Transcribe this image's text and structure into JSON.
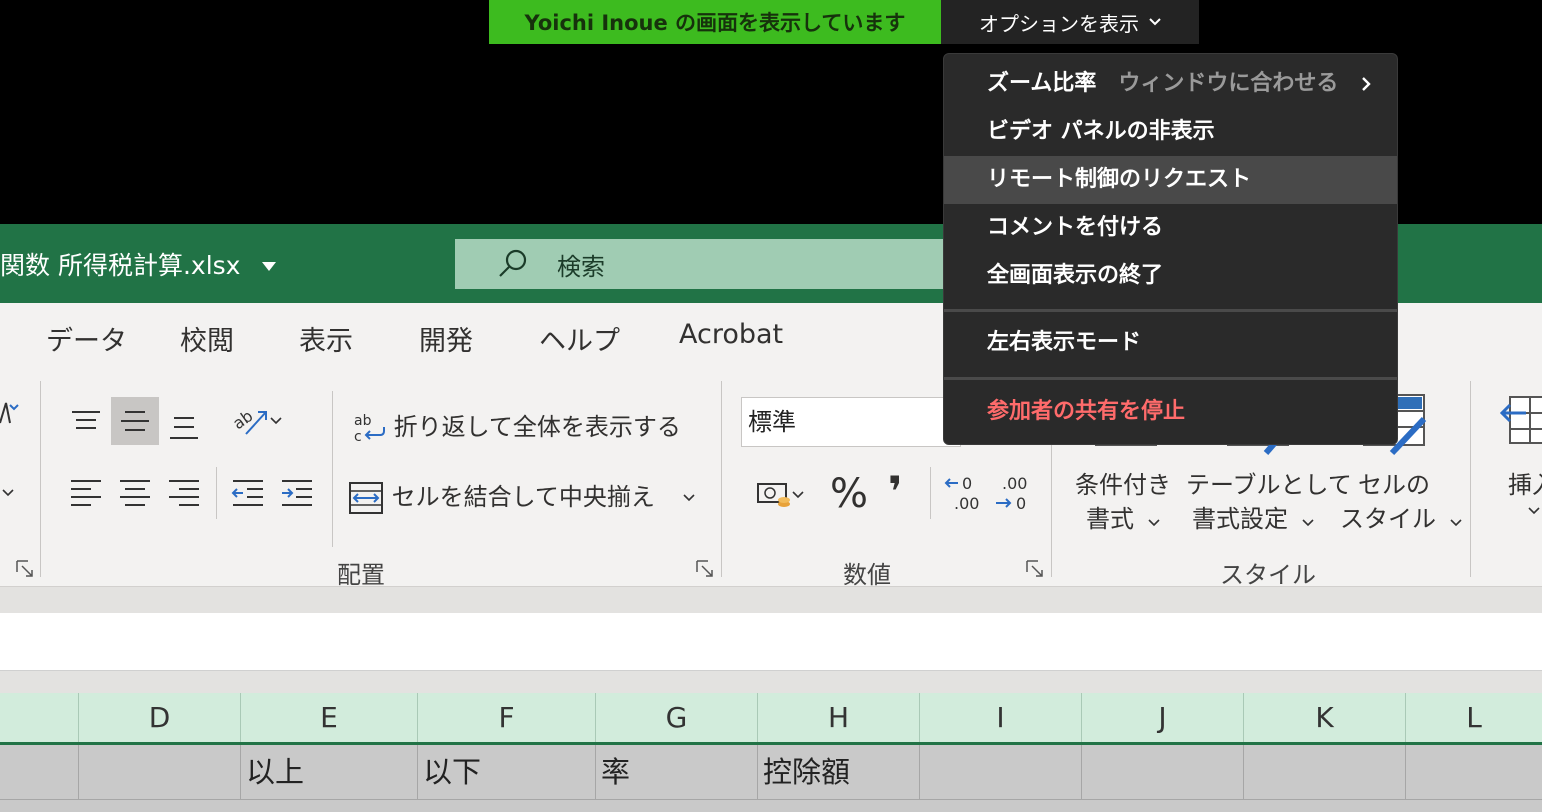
{
  "zoom": {
    "share_status": "Yoichi Inoue の画面を表示しています",
    "options_label": "オプションを表示",
    "menu": {
      "zoom_label": "ズーム比率",
      "zoom_value": "ウィンドウに合わせる",
      "hide_video": "ビデオ パネルの非表示",
      "request_control": "リモート制御のリクエスト",
      "annotate": "コメントを付ける",
      "exit_fullscreen": "全画面表示の終了",
      "side_by_side": "左右表示モード",
      "stop_share": "参加者の共有を停止",
      "stop_color": "#ff6b6b"
    }
  },
  "excel": {
    "title": "関数 所得税計算.xlsx",
    "search_placeholder": "検索",
    "tabs": [
      "データ",
      "校閲",
      "表示",
      "開発",
      "ヘルプ",
      "Acrobat"
    ],
    "ribbon": {
      "wrap_text": "折り返して全体を表示する",
      "merge_center": "セルを結合して中央揃え",
      "group_alignment": "配置",
      "number_format": "標準",
      "group_number": "数値",
      "percent": "%",
      "comma": "❜",
      "cond_format_1": "条件付き",
      "cond_format_2": "書式",
      "table_format_1": "テーブルとして",
      "table_format_2": "書式設定",
      "cell_style_1": "セルの",
      "cell_style_2": "スタイル",
      "group_style": "スタイル",
      "insert": "挿入"
    },
    "columns": [
      "D",
      "E",
      "F",
      "G",
      "H",
      "I",
      "J",
      "K",
      "L"
    ],
    "row1": [
      "",
      "",
      "以上",
      "以下",
      "率",
      "控除額",
      "",
      "",
      "",
      ""
    ]
  }
}
